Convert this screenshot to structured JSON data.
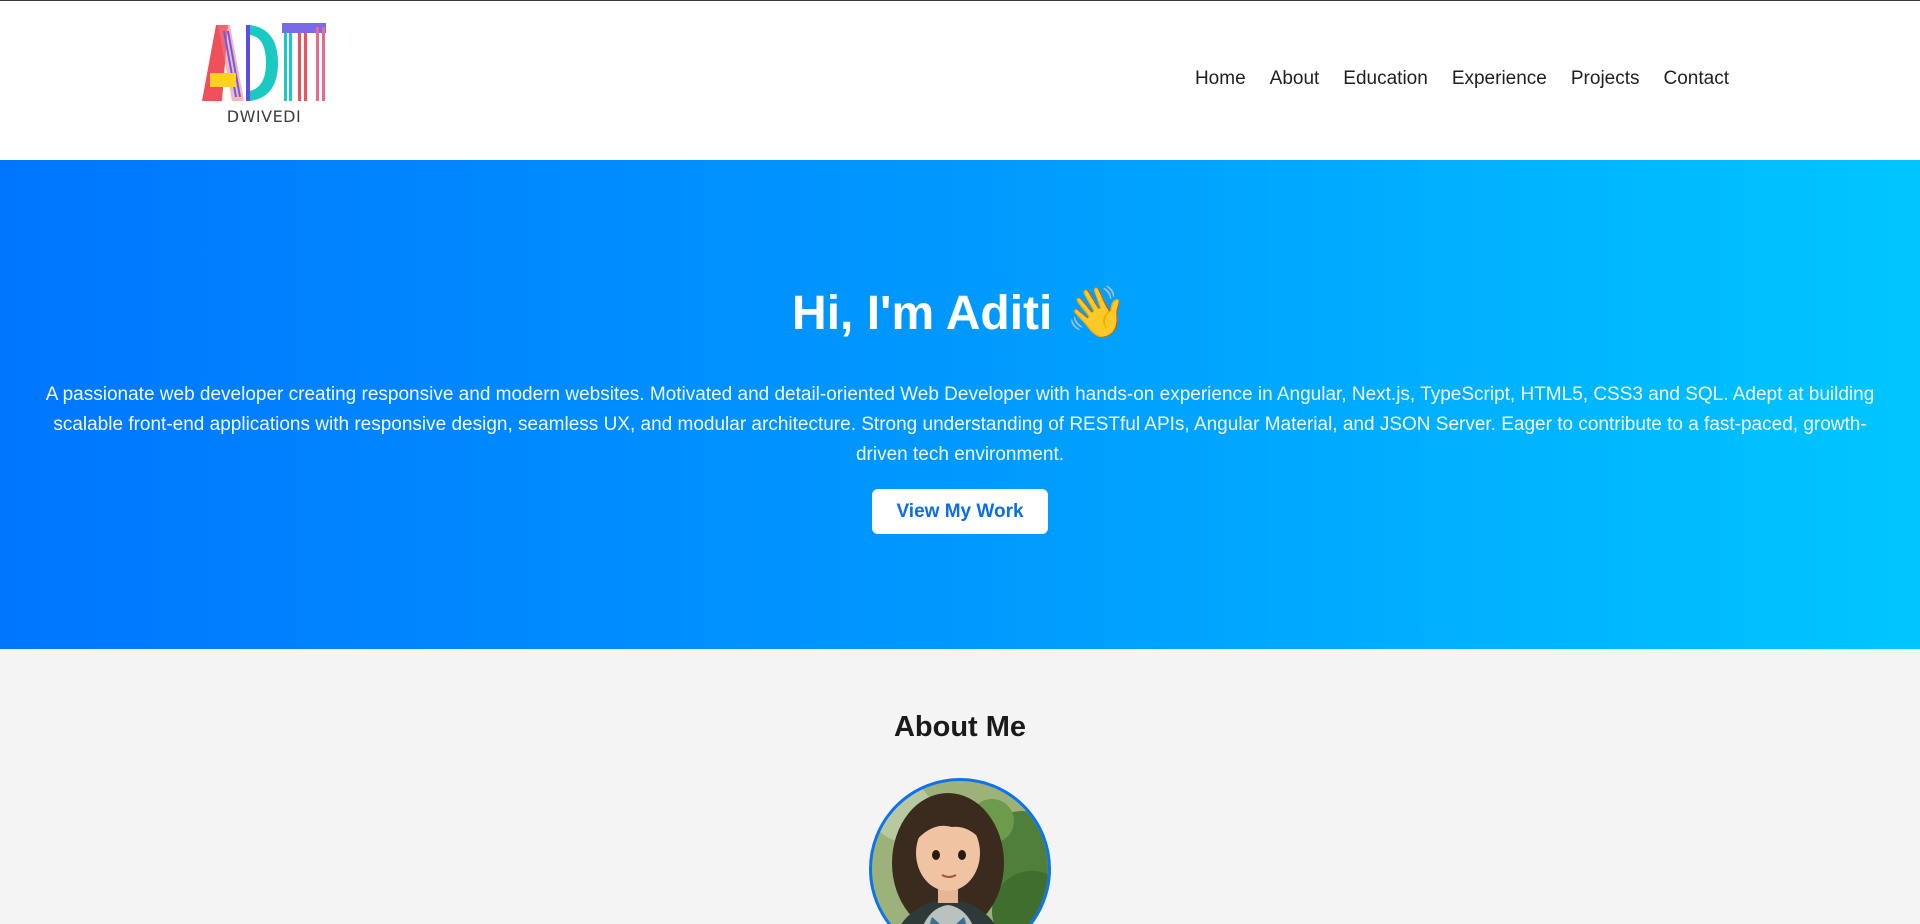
{
  "header": {
    "logo_alt": "ADITI",
    "logo_sub": "DWIVEDI",
    "nav": [
      {
        "label": "Home"
      },
      {
        "label": "About"
      },
      {
        "label": "Education"
      },
      {
        "label": "Experience"
      },
      {
        "label": "Projects"
      },
      {
        "label": "Contact"
      }
    ]
  },
  "hero": {
    "title": "Hi, I'm Aditi",
    "wave_icon": "👋",
    "description": "A passionate web developer creating responsive and modern websites. Motivated and detail-oriented Web Developer with hands-on experience in Angular, Next.js, TypeScript, HTML5, CSS3 and SQL. Adept at building scalable front-end applications with responsive design, seamless UX, and modular architecture. Strong understanding of RESTful APIs, Angular Material, and JSON Server. Eager to contribute to a fast-paced, growth-driven tech environment.",
    "button_label": "View My Work",
    "gradient": [
      "#0076ff",
      "#00c6ff"
    ]
  },
  "about": {
    "title": "About Me"
  },
  "colors": {
    "accent": "#0a6ee6",
    "avatar_border": "#0a73f0"
  }
}
